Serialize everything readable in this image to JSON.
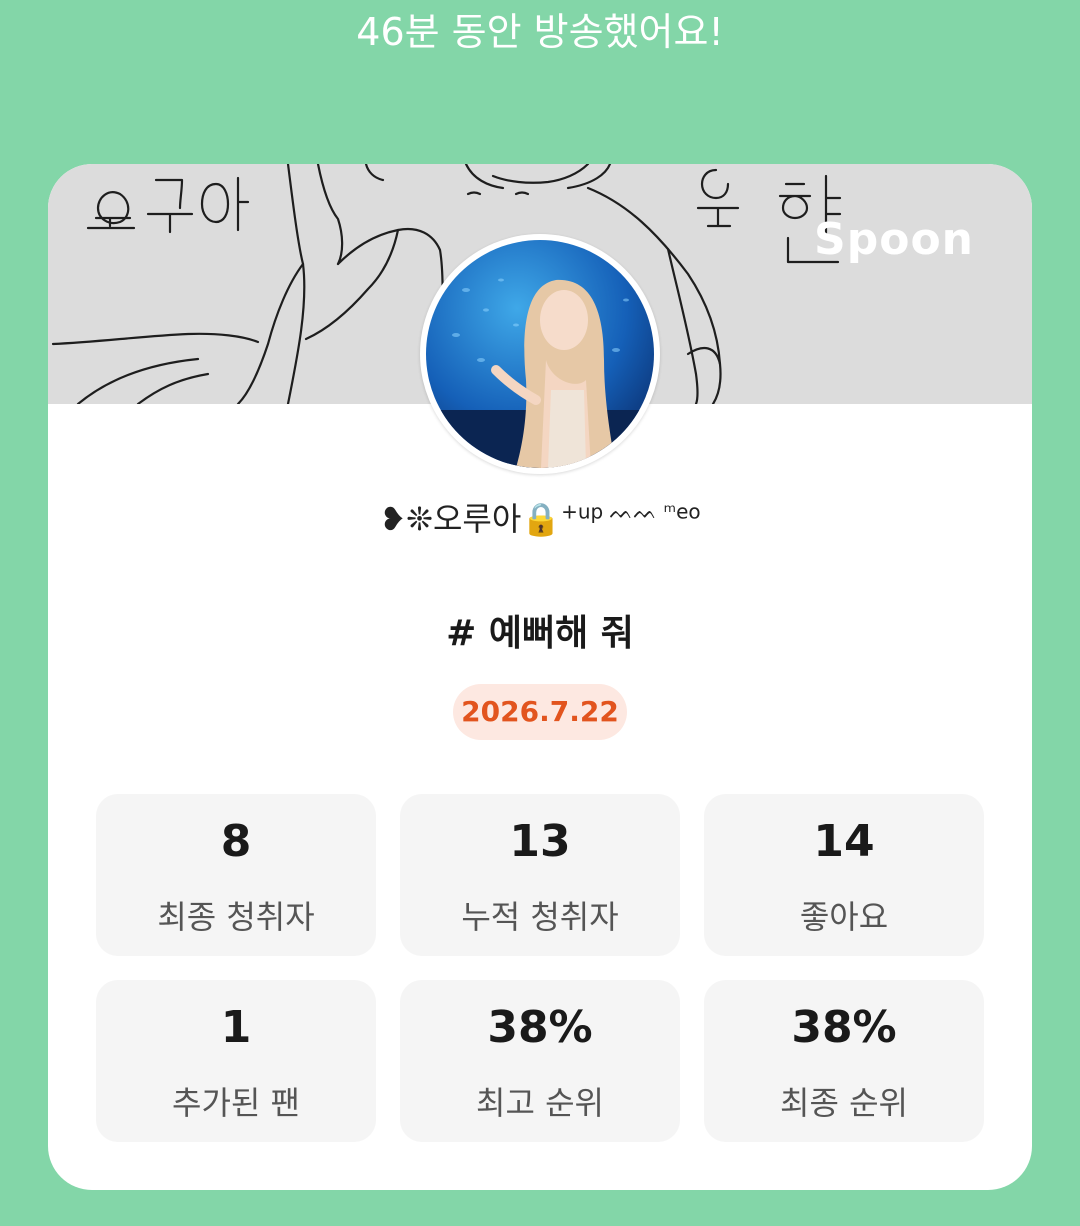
{
  "headline": "46분 동안 방송했어요!",
  "banner": {
    "brand": "Spoon",
    "sketch_text_left": "오루아",
    "sketch_text_right": "우현"
  },
  "profile": {
    "nickname": "❥❊오루아🔒",
    "nickname_sup": "+up ᨓᨓ ᵐeo"
  },
  "broadcast": {
    "title": "# 예뻐해 줘",
    "date": "2026.7.22"
  },
  "stats": [
    {
      "value": "8",
      "label": "최종 청취자"
    },
    {
      "value": "13",
      "label": "누적 청취자"
    },
    {
      "value": "14",
      "label": "좋아요"
    },
    {
      "value": "1",
      "label": "추가된 팬"
    },
    {
      "value": "38%",
      "label": "최고 순위"
    },
    {
      "value": "38%",
      "label": "최종 순위"
    }
  ],
  "colors": {
    "background": "#83d6a8",
    "date_accent": "#e2541e",
    "date_pill": "#fde8e1"
  }
}
